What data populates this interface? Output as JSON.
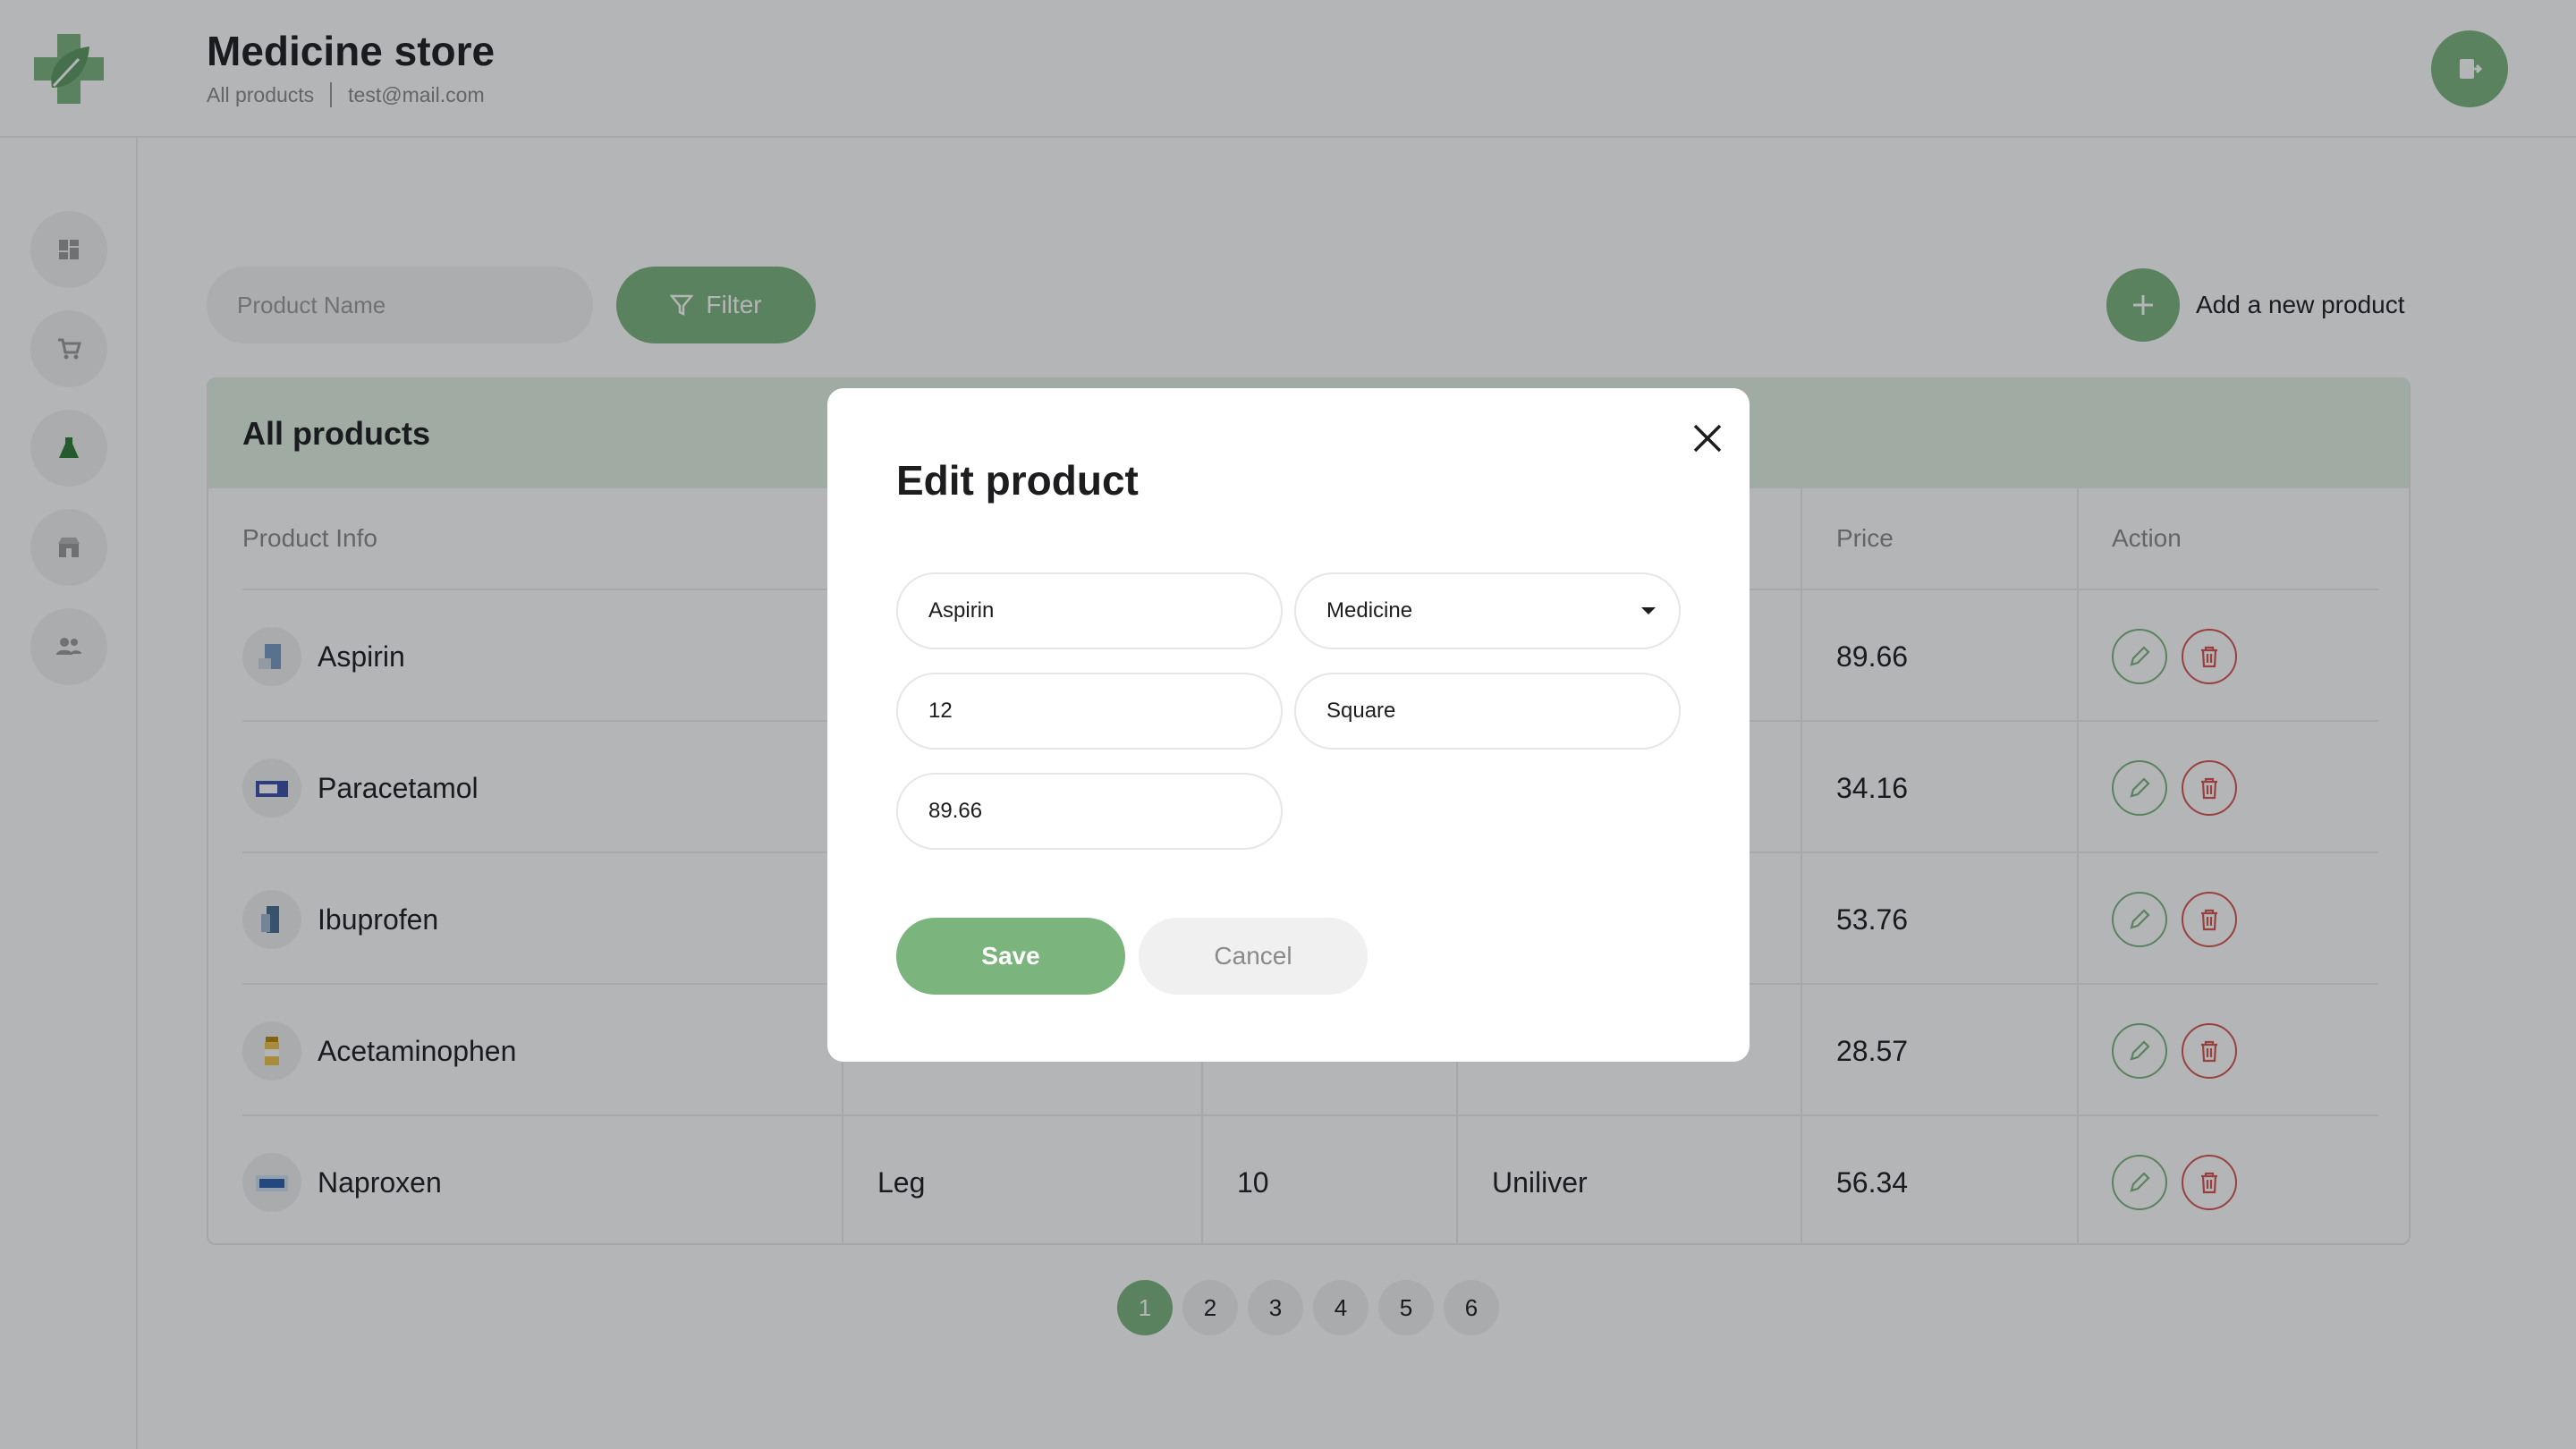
{
  "header": {
    "title": "Medicine store",
    "breadcrumb": "All products",
    "user_email": "test@mail.com"
  },
  "sidebar": {
    "items": [
      {
        "icon": "dashboard-icon"
      },
      {
        "icon": "cart-icon"
      },
      {
        "icon": "flask-icon",
        "active": true
      },
      {
        "icon": "store-icon"
      },
      {
        "icon": "users-icon"
      }
    ]
  },
  "toolbar": {
    "search_placeholder": "Product Name",
    "filter_label": "Filter",
    "add_label": "Add a new product"
  },
  "table": {
    "title": "All products",
    "columns": [
      "Product Info",
      "",
      "",
      "",
      "Price",
      "Action"
    ],
    "rows": [
      {
        "name": "Aspirin",
        "type": "",
        "quantity": "",
        "brand": "",
        "price": "89.66"
      },
      {
        "name": "Paracetamol",
        "type": "",
        "quantity": "",
        "brand": "",
        "price": "34.16"
      },
      {
        "name": "Ibuprofen",
        "type": "",
        "quantity": "",
        "brand": "",
        "price": "53.76"
      },
      {
        "name": "Acetaminophen",
        "type": "",
        "quantity": "",
        "brand": "",
        "price": "28.57"
      },
      {
        "name": "Naproxen",
        "type": "Leg",
        "quantity": "10",
        "brand": "Uniliver",
        "price": "56.34"
      }
    ]
  },
  "pagination": {
    "pages": [
      "1",
      "2",
      "3",
      "4",
      "5",
      "6"
    ],
    "current": "1"
  },
  "modal": {
    "title": "Edit product",
    "name_value": "Aspirin",
    "category_value": "Medicine",
    "quantity_value": "12",
    "brand_value": "Square",
    "price_value": "89.66",
    "save_label": "Save",
    "cancel_label": "Cancel"
  },
  "colors": {
    "accent": "#7cb47e",
    "danger": "#d9534f",
    "table_header_bg": "#e3f0e3"
  }
}
